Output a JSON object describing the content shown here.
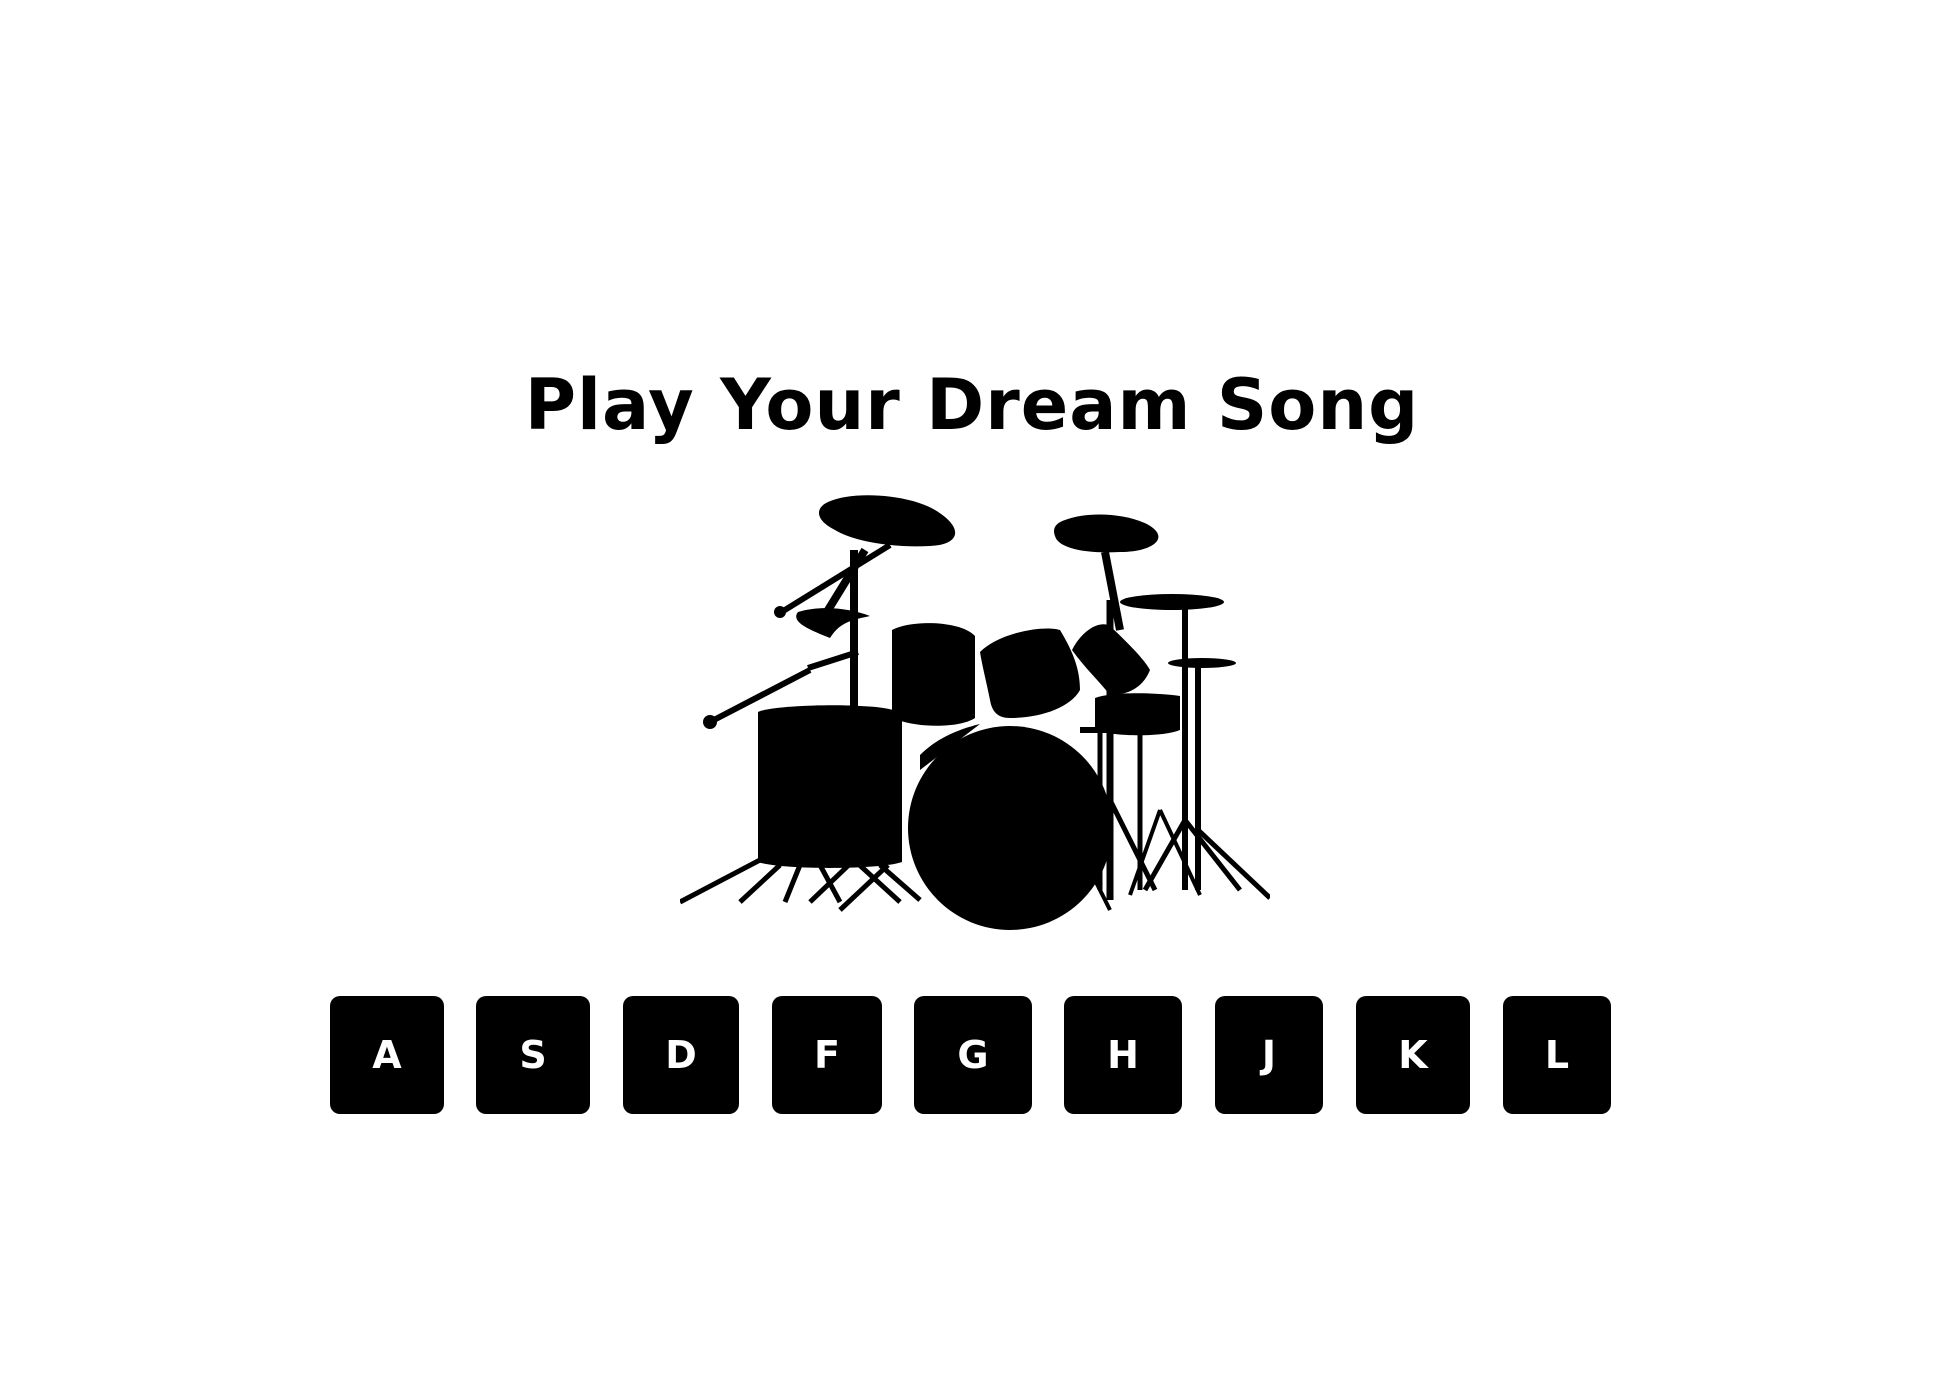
{
  "title": "Play Your Dream Song",
  "image": {
    "name": "drum-kit-silhouette",
    "color": "#000000"
  },
  "keys": [
    {
      "letter": "A"
    },
    {
      "letter": "S"
    },
    {
      "letter": "D"
    },
    {
      "letter": "F"
    },
    {
      "letter": "G"
    },
    {
      "letter": "H"
    },
    {
      "letter": "J"
    },
    {
      "letter": "K"
    },
    {
      "letter": "L"
    }
  ],
  "colors": {
    "background": "#ffffff",
    "key_background": "#000000",
    "key_text": "#ffffff",
    "title": "#000000"
  }
}
